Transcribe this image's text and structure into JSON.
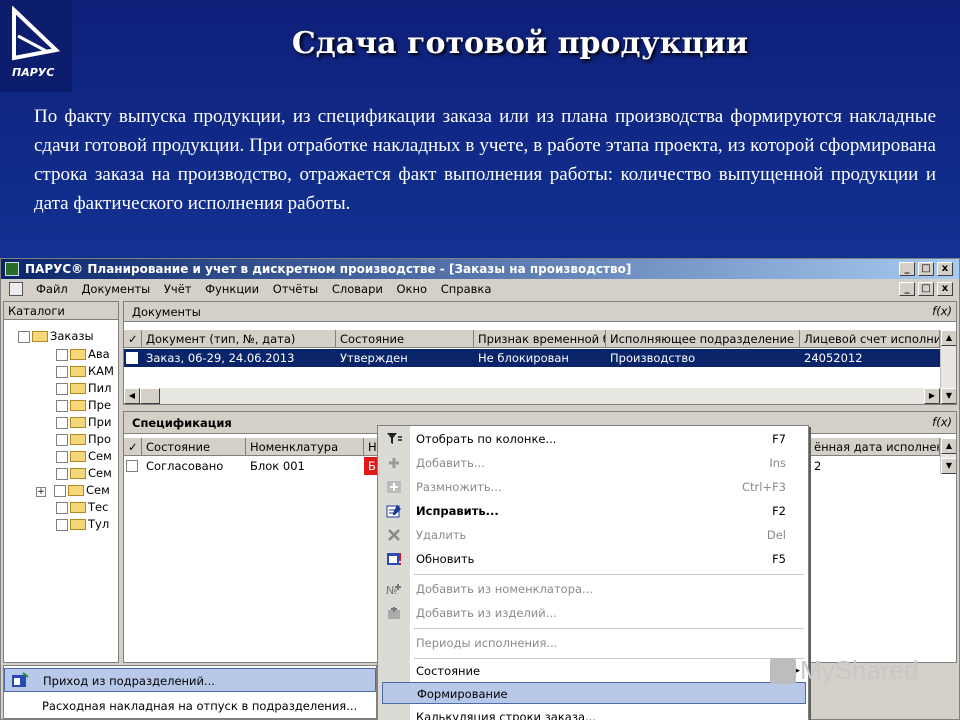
{
  "slide": {
    "title": "Сдача готовой продукции",
    "logo_text": "ПАРУС",
    "body": "По факту выпуска продукции, из спецификации заказа или из плана производства формируются накладные сдачи готовой продукции. При отработке накладных в учете, в работе этапа проекта, из которой сформирована строка заказа на производство, отражается факт выполнения работы: количество выпущенной продукции и дата фактического исполнения работы."
  },
  "window": {
    "title": "ПАРУС® Планирование и учет в дискретном производстве - [Заказы на производство]",
    "btn_min": "_",
    "btn_max": "□",
    "btn_close": "x"
  },
  "menu": [
    "Файл",
    "Документы",
    "Учёт",
    "Функции",
    "Отчёты",
    "Словари",
    "Окно",
    "Справка"
  ],
  "catalogs": {
    "header": "Каталоги",
    "root": "Заказы",
    "items": [
      "Ава",
      "КАМ",
      "Пил",
      "Пре",
      "При",
      "Про",
      "Сем",
      "Сем",
      "Сем",
      "Тес",
      "Тул"
    ],
    "expand_mark": "+"
  },
  "documents": {
    "header": "Документы",
    "fx": "f(x)",
    "check_col": "✓",
    "columns": [
      "Документ (тип, №, дата)",
      "Состояние",
      "Признак временной б",
      "Исполняющее подразделение",
      "Лицевой счет исполни"
    ],
    "rows": [
      [
        "Заказ, 06-29, 24.06.2013",
        "Утвержден",
        "Не блокирован",
        "Производство",
        "24052012"
      ]
    ]
  },
  "spec": {
    "header": "Спецификация",
    "fx": "f(x)",
    "check_col": "✓",
    "columns": [
      "Состояние",
      "Номенклатура",
      "Н"
    ],
    "right_column": "ённая дата исполнен",
    "rows": [
      {
        "state": "Согласовано",
        "item": "Блок 001",
        "flag": "Б",
        "right": "2"
      }
    ]
  },
  "context_menu": [
    {
      "label": "Отобрать по колонке...",
      "shortcut": "F7",
      "icon": "filter-icon",
      "state": "normal"
    },
    {
      "label": "Добавить...",
      "shortcut": "Ins",
      "icon": "plus-icon",
      "state": "disabled"
    },
    {
      "label": "Размножить...",
      "shortcut": "Ctrl+F3",
      "icon": "duplicate-icon",
      "state": "disabled"
    },
    {
      "label": "Исправить...",
      "shortcut": "F2",
      "icon": "edit-icon",
      "state": "bold"
    },
    {
      "label": "Удалить",
      "shortcut": "Del",
      "icon": "delete-icon",
      "state": "disabled"
    },
    {
      "label": "Обновить",
      "shortcut": "F5",
      "icon": "refresh-icon",
      "state": "normal"
    },
    {
      "label": "Добавить из номенклатора...",
      "shortcut": "",
      "icon": "nomenclature-icon",
      "state": "disabled"
    },
    {
      "label": "Добавить из изделий...",
      "shortcut": "",
      "icon": "products-icon",
      "state": "disabled"
    },
    {
      "label": "Периоды исполнения...",
      "shortcut": "",
      "icon": "",
      "state": "disabled"
    },
    {
      "label": "Состояние",
      "shortcut": "",
      "icon": "",
      "state": "submenu"
    },
    {
      "label": "Формирование",
      "shortcut": "",
      "icon": "",
      "state": "highlighted"
    },
    {
      "label": "Калькуляция строки заказа...",
      "shortcut": "",
      "icon": "",
      "state": "normal"
    }
  ],
  "submenu": [
    {
      "label": "Приход из подразделений...",
      "state": "highlighted"
    },
    {
      "label": "Расходная накладная на отпуск в подразделения...",
      "state": "normal"
    }
  ],
  "watermark": "MyShared",
  "colors": {
    "slide_bg": "#123494",
    "titlebar": "#0a246a",
    "selection": "#0a246a",
    "menu_highlight": "#b8c8e8",
    "red_flag": "#e01818"
  }
}
